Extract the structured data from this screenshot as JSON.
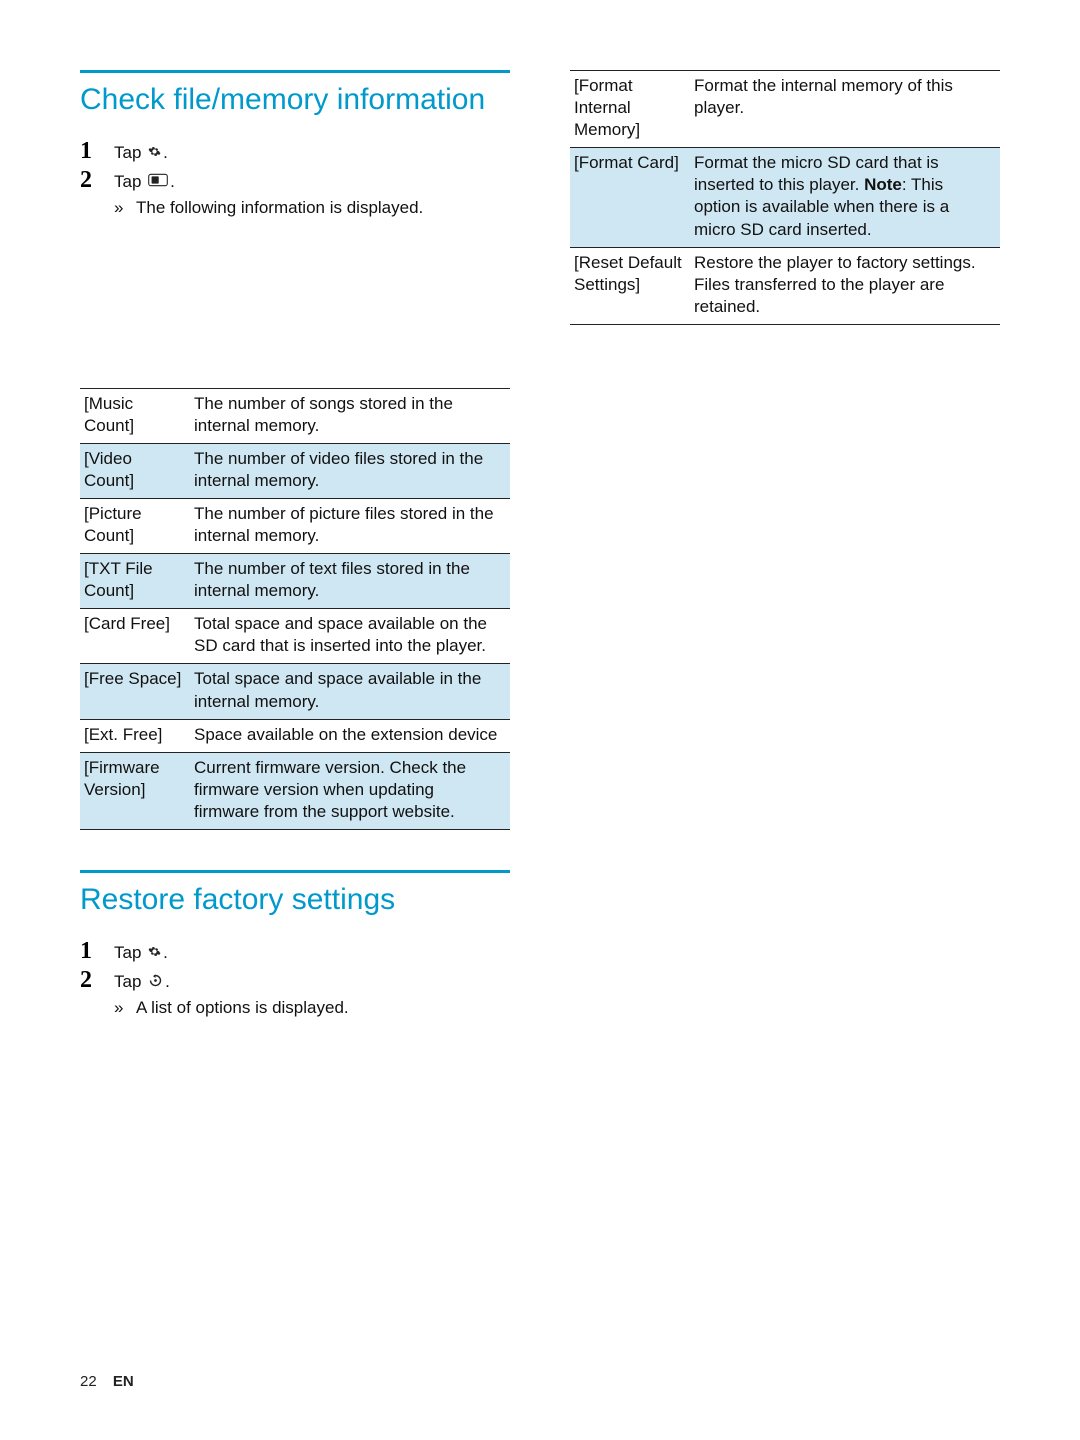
{
  "left": {
    "section1": {
      "title": "Check file/memory information",
      "steps": [
        {
          "num": "1",
          "text_before": "Tap ",
          "icon": "gear",
          "text_after": "."
        },
        {
          "num": "2",
          "text_before": "Tap  ",
          "icon": "sd-card",
          "text_after": "."
        }
      ],
      "substep": "The following information is displayed.",
      "table": [
        {
          "label": "[Music Count]",
          "desc": "The number of songs stored in the internal memory."
        },
        {
          "label": "[Video Count]",
          "desc": "The number of video files stored in the internal memory."
        },
        {
          "label": "[Picture Count]",
          "desc": "The number of picture files stored in the internal memory."
        },
        {
          "label": "[TXT File Count]",
          "desc": "The number of text files stored in the internal memory."
        },
        {
          "label": "[Card Free]",
          "desc": "Total space and space available on the SD card that is inserted into the player."
        },
        {
          "label": "[Free Space]",
          "desc": "Total space and space available in the internal memory."
        },
        {
          "label": "[Ext. Free]",
          "desc": "Space available on the extension device"
        },
        {
          "label": "[Firmware Version]",
          "desc": "Current firmware version. Check the firmware version when updating firmware from the support website."
        }
      ]
    },
    "section2": {
      "title": "Restore factory settings",
      "steps": [
        {
          "num": "1",
          "text_before": "Tap ",
          "icon": "gear",
          "text_after": "."
        },
        {
          "num": "2",
          "text_before": "Tap ",
          "icon": "restore",
          "text_after": "."
        }
      ],
      "substep": "A list of options is displayed."
    }
  },
  "right": {
    "table": [
      {
        "label": "[Format Internal Memory]",
        "desc_before": "Format the internal memory of this player.",
        "note": "",
        "desc_after": ""
      },
      {
        "label": "[Format Card]",
        "desc_before": "Format the micro SD card that is inserted to this player. ",
        "note": "Note",
        "desc_after": ": This option is available when there is a micro SD card inserted."
      },
      {
        "label": "[Reset Default Settings]",
        "desc_before": "Restore the player to factory settings. Files transferred to the player are retained.",
        "note": "",
        "desc_after": ""
      }
    ]
  },
  "footer": {
    "page": "22",
    "lang": "EN"
  }
}
